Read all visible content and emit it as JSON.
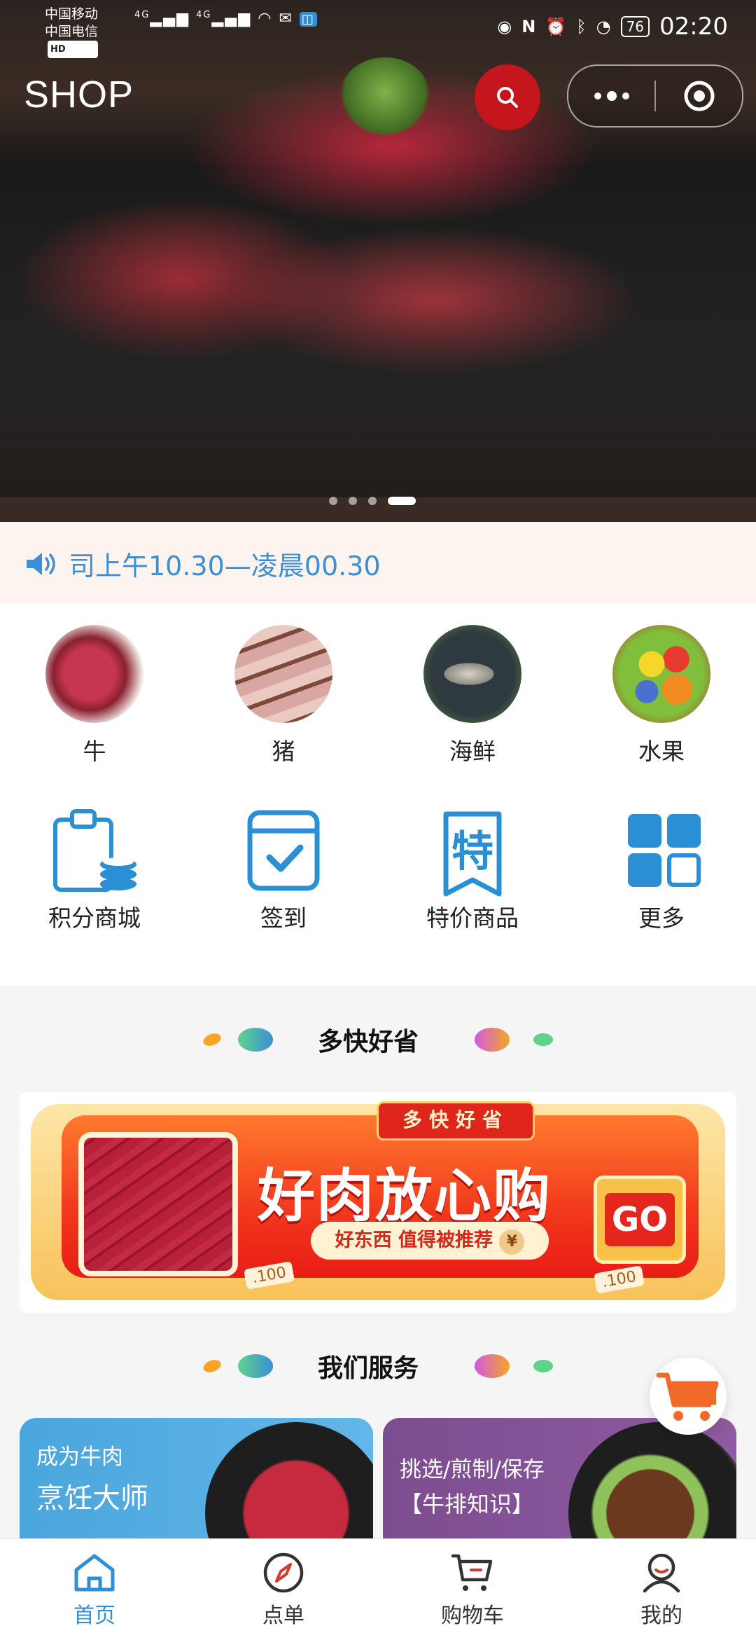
{
  "status_bar": {
    "carrier1": "中国移动",
    "carrier2": "中国电信",
    "hd": "HD",
    "signal1": "4G",
    "signal2": "4G",
    "battery": "76",
    "time": "02:20"
  },
  "header": {
    "title": "SHOP"
  },
  "carousel": {
    "dot_count": 4,
    "active_index": 3
  },
  "notice": {
    "text": "司上午10.30—凌晨00.30"
  },
  "categories": [
    {
      "label": "牛",
      "icon": "beef-image"
    },
    {
      "label": "猪",
      "icon": "pork-image"
    },
    {
      "label": "海鲜",
      "icon": "seafood-image"
    },
    {
      "label": "水果",
      "icon": "fruit-image"
    }
  ],
  "features": [
    {
      "label": "积分商城",
      "icon": "clipboard-coins-icon"
    },
    {
      "label": "签到",
      "icon": "calendar-check-icon"
    },
    {
      "label": "特价商品",
      "icon": "special-price-icon"
    },
    {
      "label": "更多",
      "icon": "grid-more-icon"
    }
  ],
  "section1": {
    "title": "多快好省"
  },
  "promo_banner": {
    "tag": "多快好省",
    "title": "好肉放心购",
    "subtitle": "好东西 值得被推荐",
    "go": "GO",
    "ticket1": "100",
    "ticket2": "100",
    "yen": "¥"
  },
  "section2": {
    "title": "我们服务"
  },
  "service_cards": [
    {
      "line1": "成为牛肉",
      "line2": "烹饪大师"
    },
    {
      "line1": "挑选/煎制/保存",
      "line2": "【牛排知识】"
    }
  ],
  "tabbar": [
    {
      "label": "首页",
      "active": true
    },
    {
      "label": "点单",
      "active": false
    },
    {
      "label": "购物车",
      "active": false
    },
    {
      "label": "我的",
      "active": false
    }
  ],
  "colors": {
    "brand_red": "#c4161c",
    "accent_blue": "#2f8fd6",
    "notice_bg": "#fdf4ef"
  }
}
